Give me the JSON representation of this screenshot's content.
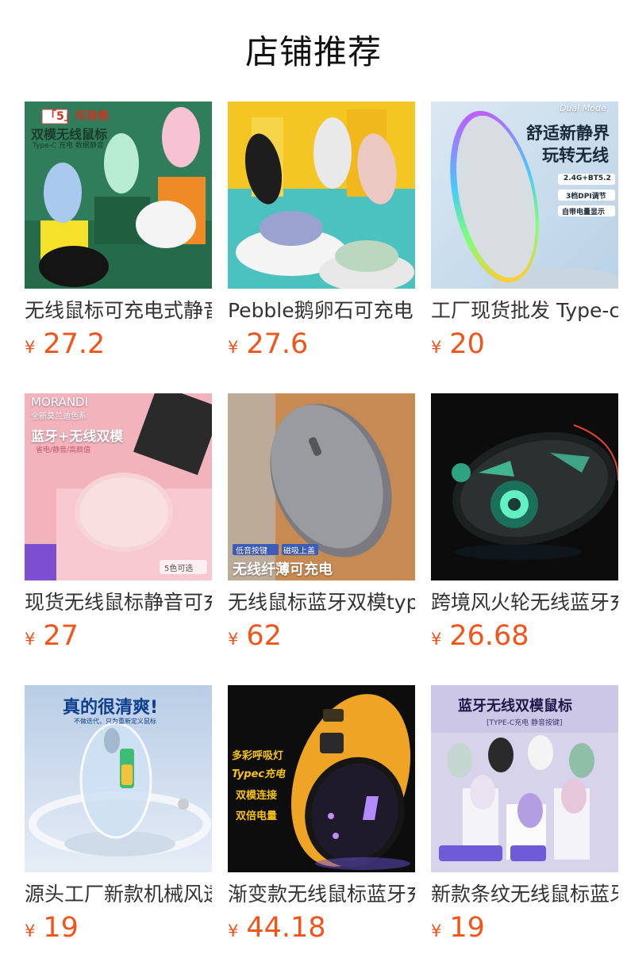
{
  "section": {
    "title": "店铺推荐"
  },
  "currency": "¥",
  "products": [
    {
      "name": "无线鼠标可充电式静音",
      "price": "27.2",
      "image_text": [
        "「5」所畏惧",
        "双模无线鼠标",
        "Type-C 充电  数据静音"
      ]
    },
    {
      "name": "Pebble鹅卵石可充电",
      "price": "27.6",
      "image_text": []
    },
    {
      "name": "工厂现货批发 Type-c",
      "price": "20",
      "image_text": [
        "Dual Mode",
        "舒适新静界",
        "玩转无线",
        "2.4G+BT5.2",
        "3档DPI调节",
        "自带电量显示"
      ]
    },
    {
      "name": "现货无线鼠标静音可充",
      "price": "27",
      "image_text": [
        "MORANDI",
        "全新莫兰迪色系",
        "蓝牙+无线双模",
        "省电/静音/高颜值",
        "5色可选"
      ]
    },
    {
      "name": "无线鼠标蓝牙双模type",
      "price": "62",
      "image_text": [
        "低音按键",
        "磁吸上盖",
        "无线纤薄可充电"
      ]
    },
    {
      "name": "跨境风火轮无线蓝牙充",
      "price": "26.68",
      "image_text": []
    },
    {
      "name": "源头工厂新款机械风透",
      "price": "19",
      "image_text": [
        "真的很清爽!",
        "不做迭代，只为重新定义鼠标"
      ]
    },
    {
      "name": "渐变款无线鼠标蓝牙充",
      "price": "44.18",
      "image_text": [
        "多彩呼吸灯",
        "Typec充电",
        "双模连接",
        "双倍电量"
      ]
    },
    {
      "name": "新款条纹无线鼠标蓝牙",
      "price": "19",
      "image_text": [
        "蓝牙无线双模鼠标",
        "[TYPE-C充电  静音按键]"
      ]
    }
  ],
  "colors": {
    "price": "#f3541b",
    "title": "#111111"
  }
}
